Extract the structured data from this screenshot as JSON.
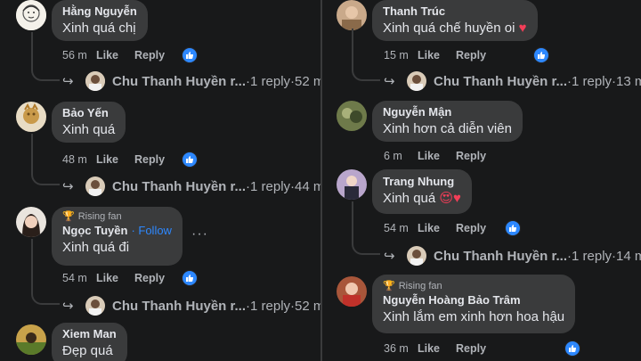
{
  "left": {
    "comments": [
      {
        "name": "Hằng Nguyễn",
        "text": "Xinh quá chị",
        "time": "56 m",
        "like": "Like",
        "reply": "Reply",
        "reply_preview": {
          "name": "Chu Thanh Huyền r...",
          "sep": " · ",
          "count": "1 reply",
          "time": "52 m"
        }
      },
      {
        "name": "Bảo Yến",
        "text": "Xinh quá",
        "time": "48 m",
        "like": "Like",
        "reply": "Reply",
        "reply_preview": {
          "name": "Chu Thanh Huyền r...",
          "sep": " · ",
          "count": "1 reply",
          "time": "44 m"
        }
      },
      {
        "badge": "Rising fan",
        "name": "Ngọc Tuyền",
        "follow": "· Follow",
        "more": "···",
        "text": "Xinh quá đi",
        "time": "54 m",
        "like": "Like",
        "reply": "Reply",
        "reply_preview": {
          "name": "Chu Thanh Huyền r...",
          "sep": " · ",
          "count": "1 reply",
          "time": "52 m"
        }
      },
      {
        "name": "Xiem Man",
        "text": "Đẹp quá"
      }
    ]
  },
  "right": {
    "comments": [
      {
        "name": "Thanh Trúc",
        "text": "Xinh quá chế huyền oi",
        "emoji": "♥",
        "time": "15 m",
        "like": "Like",
        "reply": "Reply",
        "reply_preview": {
          "name": "Chu Thanh Huyền r...",
          "sep": " · ",
          "count": "1 reply",
          "time": "13 m"
        }
      },
      {
        "name": "Nguyễn Mận",
        "text": "Xinh hơn cả diễn viên",
        "time": "6 m",
        "like": "Like",
        "reply": "Reply"
      },
      {
        "name": "Trang Nhung",
        "text": "Xinh quá",
        "emoji": "😍♥",
        "time": "54 m",
        "like": "Like",
        "reply": "Reply",
        "reply_preview": {
          "name": "Chu Thanh Huyền r...",
          "sep": " · ",
          "count": "1 reply",
          "time": "14 m"
        }
      },
      {
        "badge": "Rising fan",
        "name": "Nguyễn Hoàng Bảo Trâm",
        "text": "Xinh lắm em xinh hơn hoa hậu",
        "time": "36 m",
        "like": "Like",
        "reply": "Reply"
      }
    ]
  },
  "colors": {
    "bubble": "#3a3b3c",
    "accent": "#2d88ff",
    "muted": "#b0b3b8",
    "bg": "#18191a"
  }
}
